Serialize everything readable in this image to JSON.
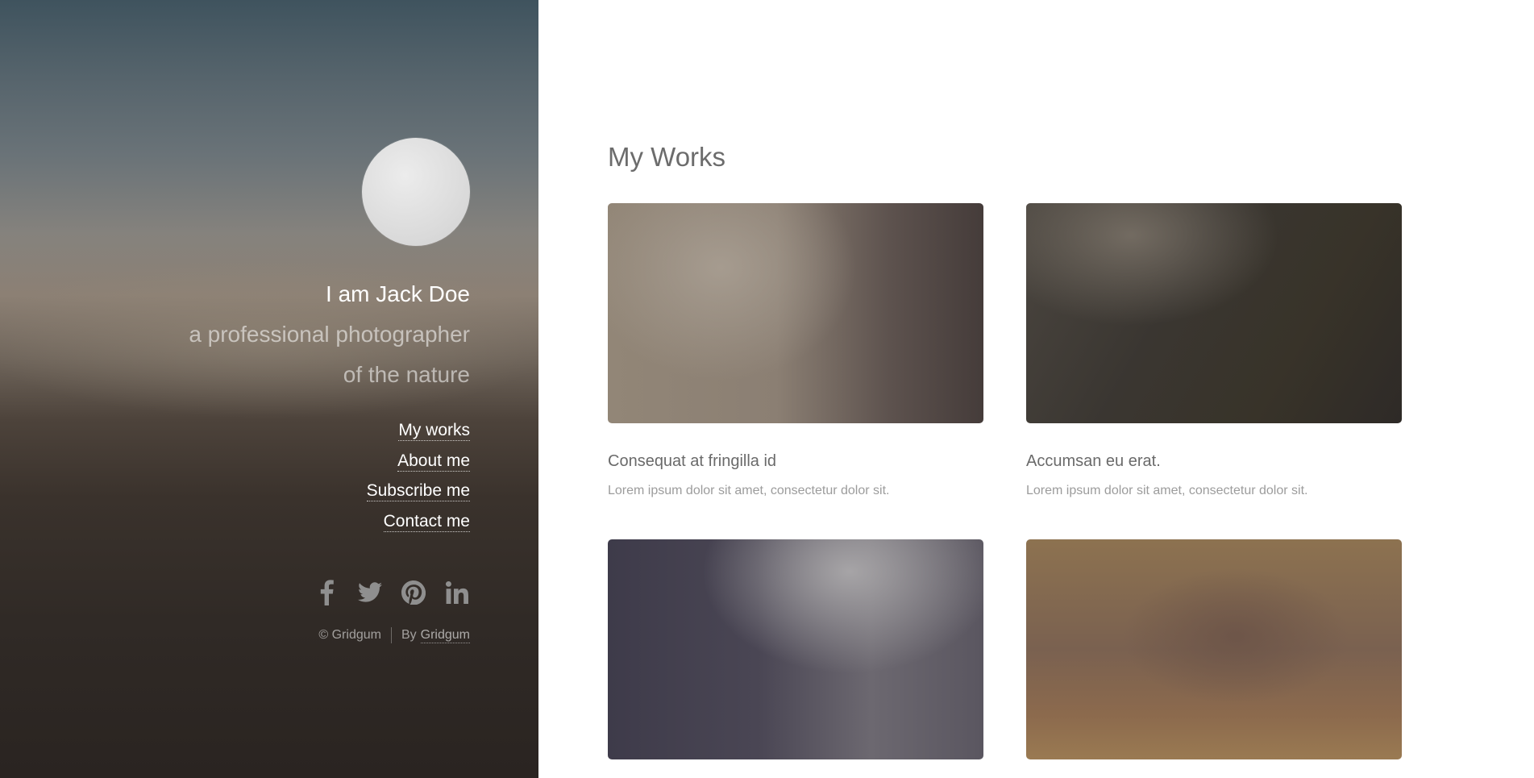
{
  "sidebar": {
    "intro": {
      "name": "I am Jack Doe",
      "line1": "a professional photographer",
      "line2": "of the nature"
    },
    "nav": [
      {
        "label": "My works"
      },
      {
        "label": "About me"
      },
      {
        "label": "Subscribe me"
      },
      {
        "label": "Contact me"
      }
    ],
    "social": [
      "facebook-icon",
      "twitter-icon",
      "pinterest-icon",
      "linkedin-icon"
    ],
    "footer": {
      "copyright": "© Gridgum",
      "by_prefix": "By",
      "by_link": "Gridgum"
    }
  },
  "main": {
    "title": "My Works",
    "works": [
      {
        "title": "Consequat at fringilla id",
        "desc": "Lorem ipsum dolor sit amet, consectetur dolor sit."
      },
      {
        "title": "Accumsan eu erat.",
        "desc": "Lorem ipsum dolor sit amet, consectetur dolor sit."
      },
      {
        "title": "",
        "desc": ""
      },
      {
        "title": "",
        "desc": ""
      }
    ]
  },
  "colors": {
    "sidebar_text": "#ffffff",
    "heading": "#6c6c6c",
    "muted": "#9c9c9c",
    "icon": "#8f8f8f"
  }
}
